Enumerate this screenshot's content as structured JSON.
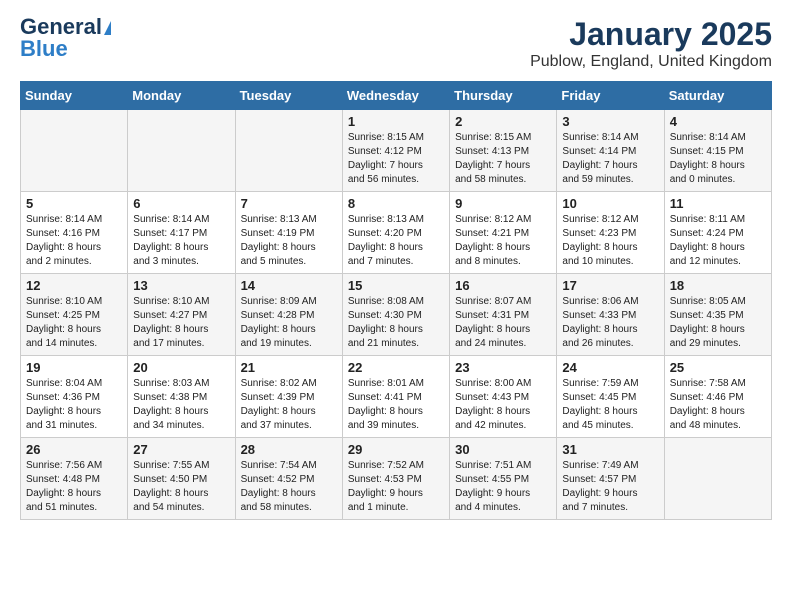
{
  "header": {
    "logo_line1": "General",
    "logo_line2": "Blue",
    "title": "January 2025",
    "subtitle": "Publow, England, United Kingdom"
  },
  "days_of_week": [
    "Sunday",
    "Monday",
    "Tuesday",
    "Wednesday",
    "Thursday",
    "Friday",
    "Saturday"
  ],
  "weeks": [
    [
      {
        "day": "",
        "info": ""
      },
      {
        "day": "",
        "info": ""
      },
      {
        "day": "",
        "info": ""
      },
      {
        "day": "1",
        "info": "Sunrise: 8:15 AM\nSunset: 4:12 PM\nDaylight: 7 hours\nand 56 minutes."
      },
      {
        "day": "2",
        "info": "Sunrise: 8:15 AM\nSunset: 4:13 PM\nDaylight: 7 hours\nand 58 minutes."
      },
      {
        "day": "3",
        "info": "Sunrise: 8:14 AM\nSunset: 4:14 PM\nDaylight: 7 hours\nand 59 minutes."
      },
      {
        "day": "4",
        "info": "Sunrise: 8:14 AM\nSunset: 4:15 PM\nDaylight: 8 hours\nand 0 minutes."
      }
    ],
    [
      {
        "day": "5",
        "info": "Sunrise: 8:14 AM\nSunset: 4:16 PM\nDaylight: 8 hours\nand 2 minutes."
      },
      {
        "day": "6",
        "info": "Sunrise: 8:14 AM\nSunset: 4:17 PM\nDaylight: 8 hours\nand 3 minutes."
      },
      {
        "day": "7",
        "info": "Sunrise: 8:13 AM\nSunset: 4:19 PM\nDaylight: 8 hours\nand 5 minutes."
      },
      {
        "day": "8",
        "info": "Sunrise: 8:13 AM\nSunset: 4:20 PM\nDaylight: 8 hours\nand 7 minutes."
      },
      {
        "day": "9",
        "info": "Sunrise: 8:12 AM\nSunset: 4:21 PM\nDaylight: 8 hours\nand 8 minutes."
      },
      {
        "day": "10",
        "info": "Sunrise: 8:12 AM\nSunset: 4:23 PM\nDaylight: 8 hours\nand 10 minutes."
      },
      {
        "day": "11",
        "info": "Sunrise: 8:11 AM\nSunset: 4:24 PM\nDaylight: 8 hours\nand 12 minutes."
      }
    ],
    [
      {
        "day": "12",
        "info": "Sunrise: 8:10 AM\nSunset: 4:25 PM\nDaylight: 8 hours\nand 14 minutes."
      },
      {
        "day": "13",
        "info": "Sunrise: 8:10 AM\nSunset: 4:27 PM\nDaylight: 8 hours\nand 17 minutes."
      },
      {
        "day": "14",
        "info": "Sunrise: 8:09 AM\nSunset: 4:28 PM\nDaylight: 8 hours\nand 19 minutes."
      },
      {
        "day": "15",
        "info": "Sunrise: 8:08 AM\nSunset: 4:30 PM\nDaylight: 8 hours\nand 21 minutes."
      },
      {
        "day": "16",
        "info": "Sunrise: 8:07 AM\nSunset: 4:31 PM\nDaylight: 8 hours\nand 24 minutes."
      },
      {
        "day": "17",
        "info": "Sunrise: 8:06 AM\nSunset: 4:33 PM\nDaylight: 8 hours\nand 26 minutes."
      },
      {
        "day": "18",
        "info": "Sunrise: 8:05 AM\nSunset: 4:35 PM\nDaylight: 8 hours\nand 29 minutes."
      }
    ],
    [
      {
        "day": "19",
        "info": "Sunrise: 8:04 AM\nSunset: 4:36 PM\nDaylight: 8 hours\nand 31 minutes."
      },
      {
        "day": "20",
        "info": "Sunrise: 8:03 AM\nSunset: 4:38 PM\nDaylight: 8 hours\nand 34 minutes."
      },
      {
        "day": "21",
        "info": "Sunrise: 8:02 AM\nSunset: 4:39 PM\nDaylight: 8 hours\nand 37 minutes."
      },
      {
        "day": "22",
        "info": "Sunrise: 8:01 AM\nSunset: 4:41 PM\nDaylight: 8 hours\nand 39 minutes."
      },
      {
        "day": "23",
        "info": "Sunrise: 8:00 AM\nSunset: 4:43 PM\nDaylight: 8 hours\nand 42 minutes."
      },
      {
        "day": "24",
        "info": "Sunrise: 7:59 AM\nSunset: 4:45 PM\nDaylight: 8 hours\nand 45 minutes."
      },
      {
        "day": "25",
        "info": "Sunrise: 7:58 AM\nSunset: 4:46 PM\nDaylight: 8 hours\nand 48 minutes."
      }
    ],
    [
      {
        "day": "26",
        "info": "Sunrise: 7:56 AM\nSunset: 4:48 PM\nDaylight: 8 hours\nand 51 minutes."
      },
      {
        "day": "27",
        "info": "Sunrise: 7:55 AM\nSunset: 4:50 PM\nDaylight: 8 hours\nand 54 minutes."
      },
      {
        "day": "28",
        "info": "Sunrise: 7:54 AM\nSunset: 4:52 PM\nDaylight: 8 hours\nand 58 minutes."
      },
      {
        "day": "29",
        "info": "Sunrise: 7:52 AM\nSunset: 4:53 PM\nDaylight: 9 hours\nand 1 minute."
      },
      {
        "day": "30",
        "info": "Sunrise: 7:51 AM\nSunset: 4:55 PM\nDaylight: 9 hours\nand 4 minutes."
      },
      {
        "day": "31",
        "info": "Sunrise: 7:49 AM\nSunset: 4:57 PM\nDaylight: 9 hours\nand 7 minutes."
      },
      {
        "day": "",
        "info": ""
      }
    ]
  ]
}
